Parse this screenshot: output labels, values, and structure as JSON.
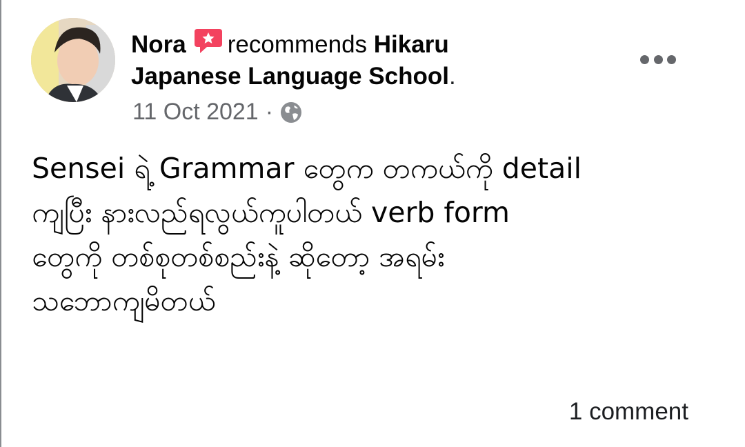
{
  "post": {
    "author": "Nora",
    "action_text": "recommends",
    "page_name": "Hikaru Japanese Language School",
    "trailing_period": ".",
    "date": "11 Oct 2021",
    "separator": "·",
    "privacy_icon": "globe-icon",
    "recommend_icon": "recommendation-icon",
    "more_icon": "more-options-icon",
    "body": "Sensei ရဲ့ Grammar တွေက တကယ်ကို detail\nကျပြီး နားလည်ရလွယ်ကူပါတယ် verb form\nတွေကို တစ်စုတစ်စည်းနဲ့ ဆိုတော့ အရမ်း\nသဘောကျမိတယ်",
    "comments_count": "1 comment"
  },
  "colors": {
    "recommend_accent": "#f3425f",
    "text_primary": "#050505",
    "text_secondary": "#65676b"
  }
}
